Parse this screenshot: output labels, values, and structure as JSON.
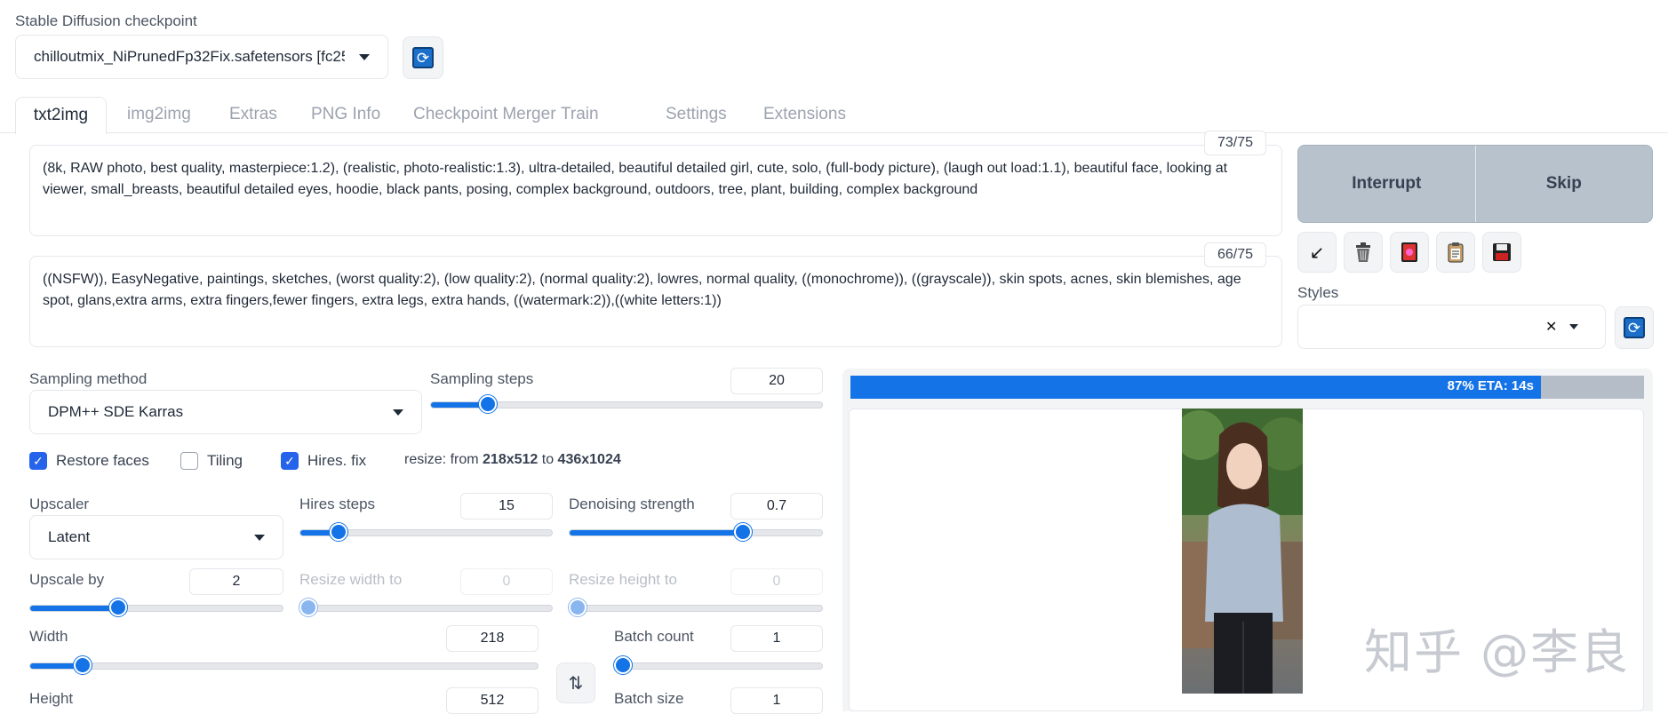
{
  "checkpoint": {
    "label": "Stable Diffusion checkpoint",
    "value": "chilloutmix_NiPrunedFp32Fix.safetensors [fc25...",
    "refresh_icon": "refresh-icon"
  },
  "tabs": [
    "txt2img",
    "img2img",
    "Extras",
    "PNG Info",
    "Checkpoint Merger",
    "Train",
    "Settings",
    "Extensions"
  ],
  "prompt": {
    "text": " (8k, RAW photo, best quality, masterpiece:1.2), (realistic, photo-realistic:1.3), ultra-detailed, beautiful detailed girl, cute, solo,  (full-body picture), (laugh out load:1.1),  beautiful face, looking at viewer, small_breasts, beautiful detailed eyes,  hoodie, black pants,  posing, complex background, outdoors, tree, plant, building, complex background",
    "token_count": "73/75"
  },
  "negative_prompt": {
    "text": "((NSFW)), EasyNegative, paintings, sketches, (worst quality:2), (low quality:2), (normal quality:2), lowres, normal quality, ((monochrome)), ((grayscale)), skin spots, acnes, skin blemishes, age spot, glans,extra arms, extra fingers,fewer fingers, extra legs,  extra hands, ((watermark:2)),((white letters:1))",
    "token_count": "66/75"
  },
  "actions": {
    "interrupt": "Interrupt",
    "skip": "Skip",
    "tool_icons": [
      "arrow-read-params-icon",
      "trash-icon",
      "red-card-extra-networks-icon",
      "clipboard-icon",
      "save-style-icon"
    ]
  },
  "styles": {
    "label": "Styles",
    "value": "",
    "clear_glyph": "✕"
  },
  "sampling": {
    "method_label": "Sampling method",
    "method_value": "DPM++ SDE Karras",
    "steps_label": "Sampling steps",
    "steps_value": "20",
    "steps_fraction": 0.13
  },
  "options": {
    "restore_faces": {
      "label": "Restore faces",
      "checked": true
    },
    "tiling": {
      "label": "Tiling",
      "checked": false
    },
    "hires_fix": {
      "label": "Hires. fix",
      "checked": true
    },
    "resize_prefix": "resize: from ",
    "resize_from": "218x512",
    "resize_mid": " to ",
    "resize_to": "436x1024"
  },
  "hires": {
    "upscaler_label": "Upscaler",
    "upscaler_value": "Latent",
    "hires_steps_label": "Hires steps",
    "hires_steps_value": "15",
    "hires_steps_fraction": 0.13,
    "denoise_label": "Denoising strength",
    "denoise_value": "0.7",
    "denoise_fraction": 0.7,
    "upscale_by_label": "Upscale by",
    "upscale_by_value": "2",
    "upscale_by_fraction": 0.34,
    "resize_width_label": "Resize width to",
    "resize_width_value": "0",
    "resize_height_label": "Resize height to",
    "resize_height_value": "0"
  },
  "size": {
    "width_label": "Width",
    "width_value": "218",
    "width_fraction": 0.09,
    "height_label": "Height",
    "height_value": "512",
    "swap_icon": "swap-dimensions-icon"
  },
  "batch": {
    "count_label": "Batch count",
    "count_value": "1",
    "count_fraction": 0.0,
    "size_label": "Batch size",
    "size_value": "1"
  },
  "progress": {
    "text": "87% ETA: 14s",
    "fraction": 0.87
  },
  "watermark": "知乎 @李良",
  "colors": {
    "accent": "#1473e6",
    "progress_track": "#b5bec8",
    "button_gray": "#b7c2cd"
  }
}
